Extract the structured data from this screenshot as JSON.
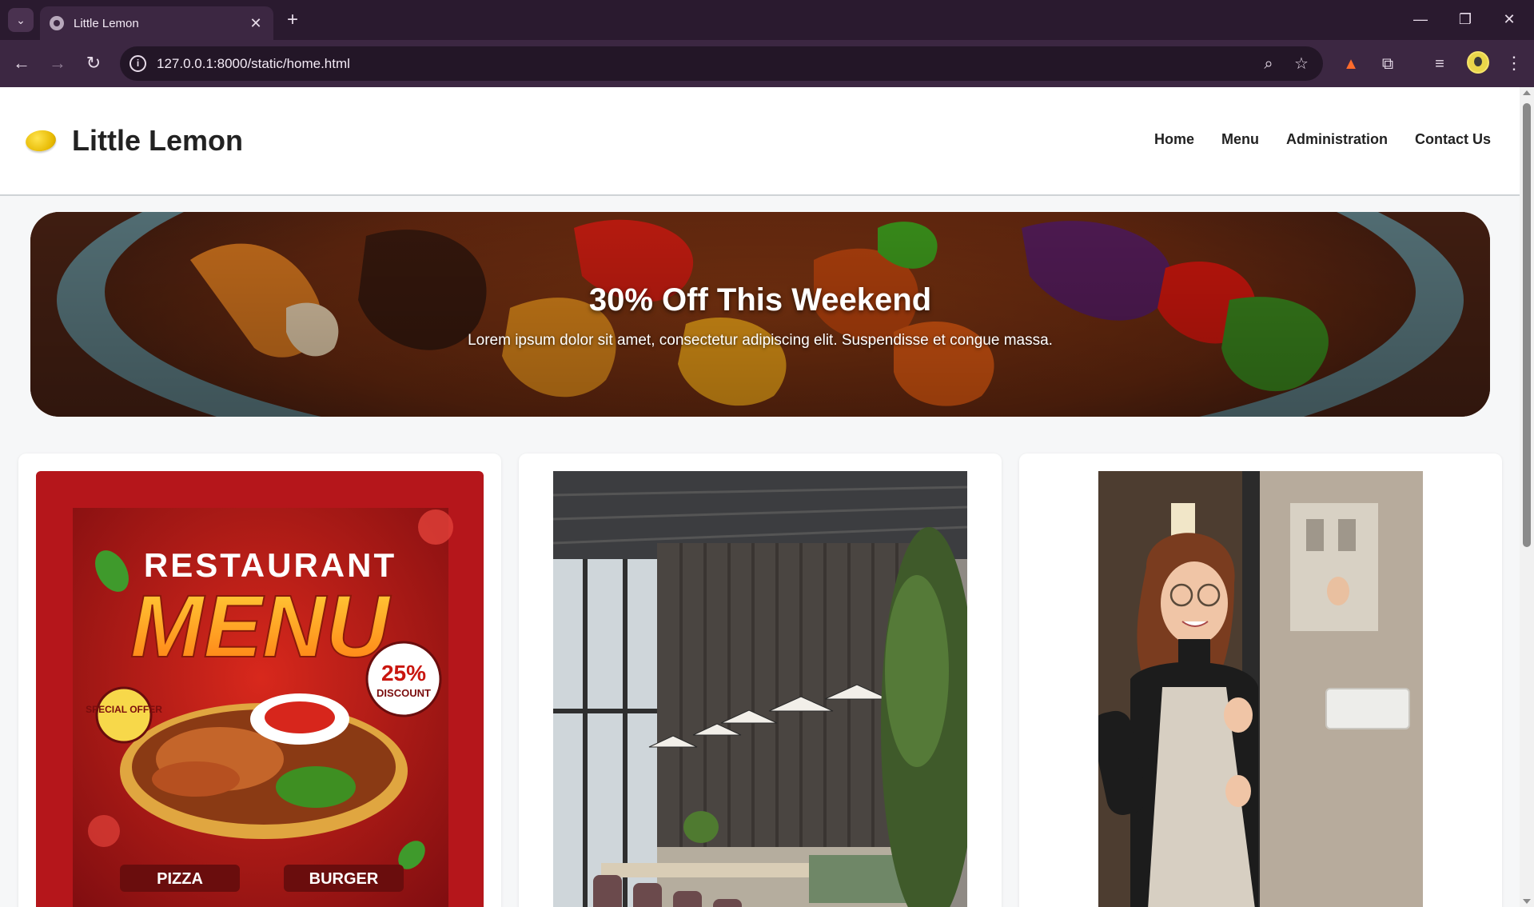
{
  "browser": {
    "tab_title": "Little Lemon",
    "tab_close": "✕",
    "new_tab": "+",
    "url": "127.0.0.1:8000/static/home.html",
    "icons": [
      "tab-search-icon",
      "globe-favicon-icon",
      "back-icon",
      "forward-icon",
      "reload-icon",
      "site-info-icon",
      "zoom-icon",
      "bookmark-star-icon",
      "fox-extension-icon",
      "extensions-puzzle-icon",
      "media-control-icon",
      "profile-avatar-icon",
      "more-menu-icon",
      "minimize-icon",
      "restore-icon",
      "close-window-icon"
    ]
  },
  "site": {
    "brand": "Little Lemon",
    "nav": [
      "Home",
      "Menu",
      "Administration",
      "Contact Us"
    ]
  },
  "hero": {
    "title": "30% Off This Weekend",
    "text": "Lorem ipsum dolor sit amet, consectetur adipiscing elit. Suspendisse et congue massa."
  },
  "cards": {
    "menu_poster": {
      "headline": "RESTAURANT",
      "title": "MENU",
      "badge_special": "SPECIAL OFFER",
      "badge_discount": "25%",
      "badge_discount_sub": "DISCOUNT",
      "label_left": "PIZZA",
      "label_right": "BURGER"
    }
  },
  "colors": {
    "chrome_dark": "#2a1a2f",
    "chrome": "#3c2742",
    "page_bg": "#f6f7f8",
    "poster_red": "#b5161b"
  }
}
